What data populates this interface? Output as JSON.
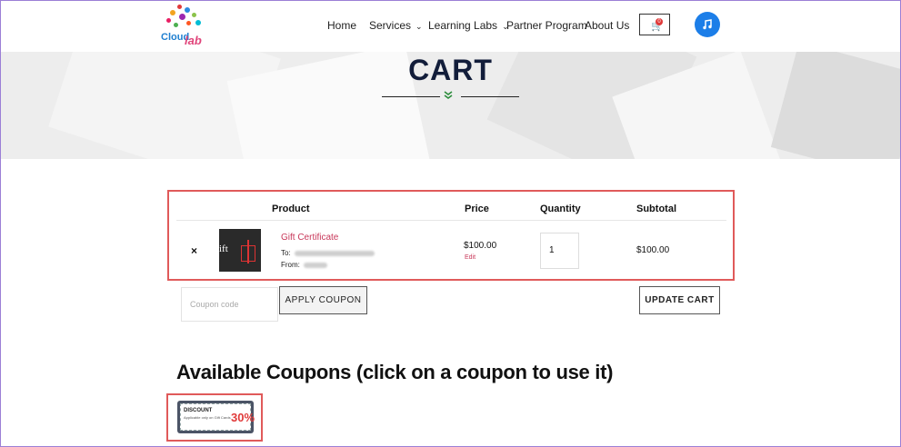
{
  "header": {
    "logo_text_1": "Cloud",
    "logo_text_2": "lab",
    "nav": [
      {
        "label": "Home"
      },
      {
        "label": "Services",
        "dropdown": true
      },
      {
        "label": "Learning Labs",
        "dropdown": true
      },
      {
        "label": "Partner Program"
      },
      {
        "label": "About Us"
      }
    ],
    "cart_count": "0",
    "chevron_glyph": "⌄"
  },
  "hero": {
    "title": "CART",
    "divider_icon": "double-chevron-down"
  },
  "cart_table": {
    "columns": [
      "Product",
      "Price",
      "Quantity",
      "Subtotal"
    ],
    "rows": [
      {
        "remove_label": "×",
        "thumbnail_text": "ift",
        "product_name": "Gift Certificate",
        "to_label": "To:",
        "from_label": "From:",
        "price": "$100.00",
        "edit_label": "Edit",
        "quantity": "1",
        "subtotal": "$100.00"
      }
    ]
  },
  "coupon": {
    "placeholder": "Coupon code",
    "apply_label": "APPLY COUPON",
    "update_label": "UPDATE CART"
  },
  "available_coupons": {
    "title": "Available Coupons (click on a coupon to use it)",
    "items": [
      {
        "label": "DISCOUNT",
        "note": "Applicable only on Gift Cards",
        "amount": "30%"
      }
    ]
  },
  "colors": {
    "accent_blue": "#1c7ee8",
    "highlight_red": "#e05a5a",
    "link_pink": "#c8385a",
    "title_navy": "#121d3a"
  }
}
